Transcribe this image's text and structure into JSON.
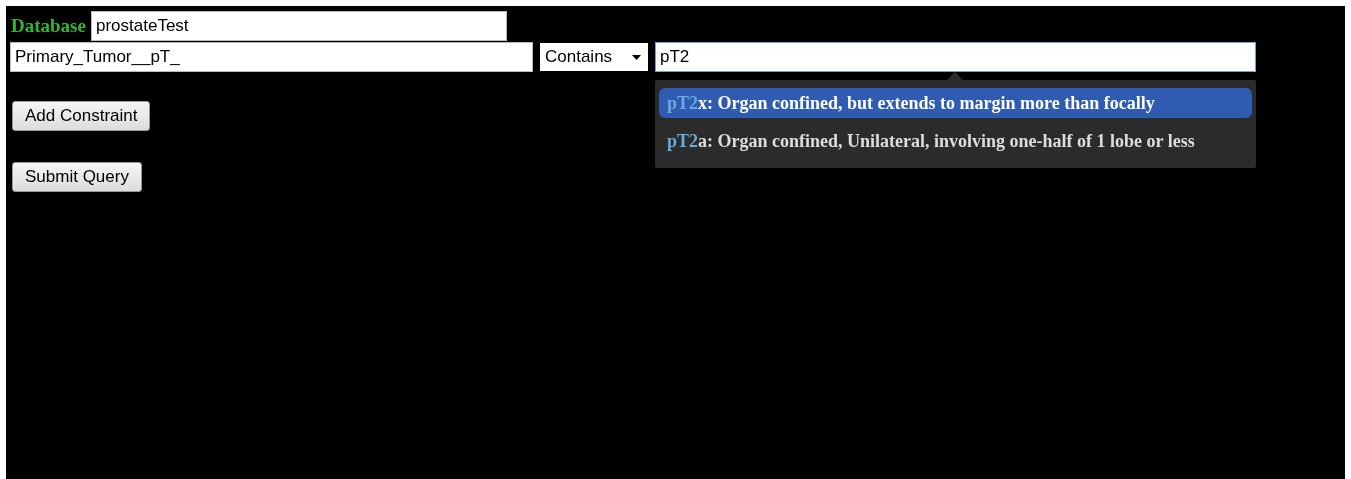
{
  "database": {
    "label": "Database",
    "value": "prostateTest"
  },
  "constraint": {
    "field": "Primary_Tumor__pT_",
    "operator": "Contains",
    "value": "pT2"
  },
  "suggestions": [
    {
      "match": "pT2",
      "rest": "x: Organ confined, but extends to margin more than focally",
      "selected": true
    },
    {
      "match": "pT2",
      "rest": "a: Organ confined, Unilateral, involving one-half of 1 lobe or less",
      "selected": false
    }
  ],
  "buttons": [
    "Add Constraint",
    "Submit Query"
  ]
}
